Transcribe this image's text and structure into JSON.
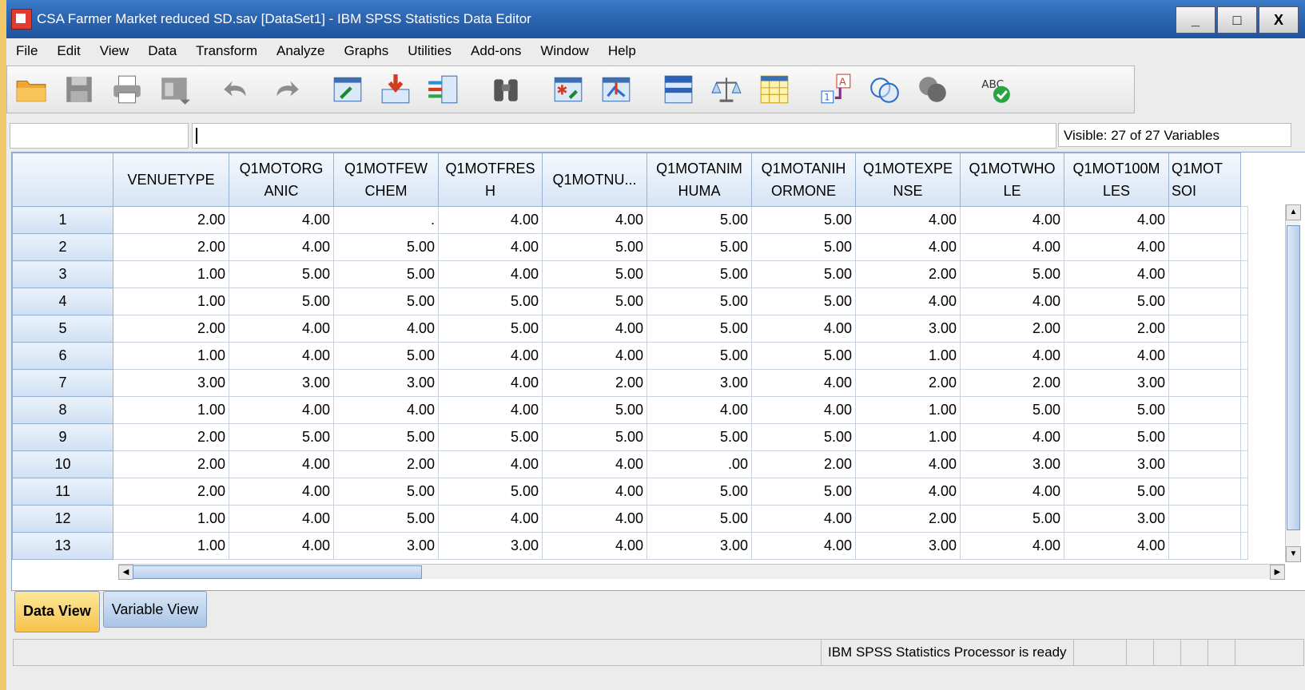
{
  "window": {
    "title": "CSA Farmer Market reduced SD.sav [DataSet1] - IBM SPSS Statistics Data Editor",
    "minimize": "_",
    "maximize": "□",
    "close": "X"
  },
  "menu": [
    "File",
    "Edit",
    "View",
    "Data",
    "Transform",
    "Analyze",
    "Graphs",
    "Utilities",
    "Add-ons",
    "Window",
    "Help"
  ],
  "toolbar_icons": [
    "open-folder-icon",
    "save-icon",
    "print-icon",
    "dialog-recall-icon",
    "undo-icon",
    "redo-icon",
    "goto-case-icon",
    "goto-variable-icon",
    "variables-icon",
    "find-icon",
    "insert-cases-icon",
    "insert-variable-icon",
    "split-file-icon",
    "weight-cases-icon",
    "select-cases-icon",
    "value-labels-icon",
    "use-sets-icon",
    "show-all-variables-icon",
    "spell-check-icon"
  ],
  "cellbar": {
    "visible": "Visible: 27 of 27 Variables"
  },
  "columns": [
    "VENUETYPE",
    "Q1MOTORG\nANIC",
    "Q1MOTFEW\nCHEM",
    "Q1MOTFRES\nH",
    "Q1MOTNU...",
    "Q1MOTANIM\nHUMA",
    "Q1MOTANIH\nORMONE",
    "Q1MOTEXPE\nNSE",
    "Q1MOTWHO\nLE",
    "Q1MOT100M\nLES",
    "Q1MOT\nSOI"
  ],
  "rows": [
    {
      "n": "1",
      "v": [
        "2.00",
        "4.00",
        ".",
        "4.00",
        "4.00",
        "5.00",
        "5.00",
        "4.00",
        "4.00",
        "4.00",
        ""
      ]
    },
    {
      "n": "2",
      "v": [
        "2.00",
        "4.00",
        "5.00",
        "4.00",
        "5.00",
        "5.00",
        "5.00",
        "4.00",
        "4.00",
        "4.00",
        ""
      ]
    },
    {
      "n": "3",
      "v": [
        "1.00",
        "5.00",
        "5.00",
        "4.00",
        "5.00",
        "5.00",
        "5.00",
        "2.00",
        "5.00",
        "4.00",
        ""
      ]
    },
    {
      "n": "4",
      "v": [
        "1.00",
        "5.00",
        "5.00",
        "5.00",
        "5.00",
        "5.00",
        "5.00",
        "4.00",
        "4.00",
        "5.00",
        ""
      ]
    },
    {
      "n": "5",
      "v": [
        "2.00",
        "4.00",
        "4.00",
        "5.00",
        "4.00",
        "5.00",
        "4.00",
        "3.00",
        "2.00",
        "2.00",
        ""
      ]
    },
    {
      "n": "6",
      "v": [
        "1.00",
        "4.00",
        "5.00",
        "4.00",
        "4.00",
        "5.00",
        "5.00",
        "1.00",
        "4.00",
        "4.00",
        ""
      ]
    },
    {
      "n": "7",
      "v": [
        "3.00",
        "3.00",
        "3.00",
        "4.00",
        "2.00",
        "3.00",
        "4.00",
        "2.00",
        "2.00",
        "3.00",
        ""
      ]
    },
    {
      "n": "8",
      "v": [
        "1.00",
        "4.00",
        "4.00",
        "4.00",
        "5.00",
        "4.00",
        "4.00",
        "1.00",
        "5.00",
        "5.00",
        ""
      ]
    },
    {
      "n": "9",
      "v": [
        "2.00",
        "5.00",
        "5.00",
        "5.00",
        "5.00",
        "5.00",
        "5.00",
        "1.00",
        "4.00",
        "5.00",
        ""
      ]
    },
    {
      "n": "10",
      "v": [
        "2.00",
        "4.00",
        "2.00",
        "4.00",
        "4.00",
        ".00",
        "2.00",
        "4.00",
        "3.00",
        "3.00",
        ""
      ]
    },
    {
      "n": "11",
      "v": [
        "2.00",
        "4.00",
        "5.00",
        "5.00",
        "4.00",
        "5.00",
        "5.00",
        "4.00",
        "4.00",
        "5.00",
        ""
      ]
    },
    {
      "n": "12",
      "v": [
        "1.00",
        "4.00",
        "5.00",
        "4.00",
        "4.00",
        "5.00",
        "4.00",
        "2.00",
        "5.00",
        "3.00",
        ""
      ]
    },
    {
      "n": "13",
      "v": [
        "1.00",
        "4.00",
        "3.00",
        "3.00",
        "4.00",
        "3.00",
        "4.00",
        "3.00",
        "4.00",
        "4.00",
        ""
      ]
    }
  ],
  "tabs": {
    "data_view": "Data View",
    "variable_view": "Variable View"
  },
  "status": "IBM SPSS Statistics Processor is ready"
}
